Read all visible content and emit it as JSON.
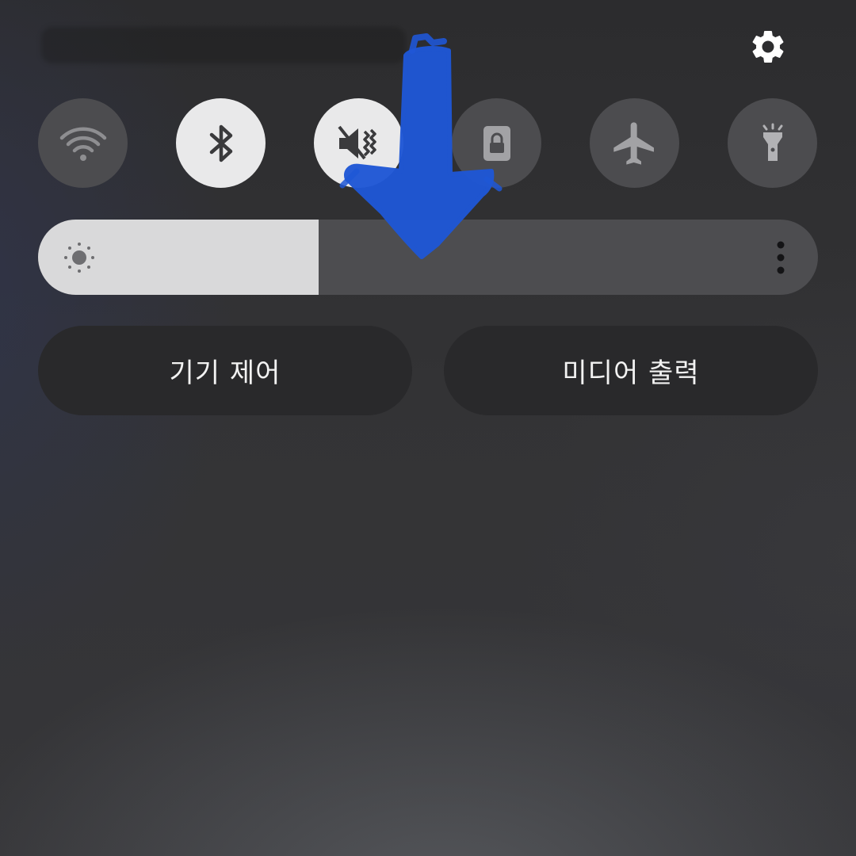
{
  "quick_panel": {
    "settings_icon": "gear-icon",
    "toggles": [
      {
        "icon": "wifi-icon",
        "state": "off"
      },
      {
        "icon": "bluetooth-icon",
        "state": "on"
      },
      {
        "icon": "sound-mute-icon",
        "state": "on"
      },
      {
        "icon": "rotation-lock-icon",
        "state": "off"
      },
      {
        "icon": "airplane-icon",
        "state": "off"
      },
      {
        "icon": "flashlight-icon",
        "state": "off"
      }
    ],
    "brightness": {
      "level": 0.36,
      "icon": "sun-icon",
      "more_icon": "vertical-dots-icon"
    },
    "device_control_label": "기기 제어",
    "media_output_label": "미디어 출력"
  },
  "annotation": {
    "type": "hand-drawn-arrow",
    "direction": "down",
    "color": "#1f57d6"
  }
}
